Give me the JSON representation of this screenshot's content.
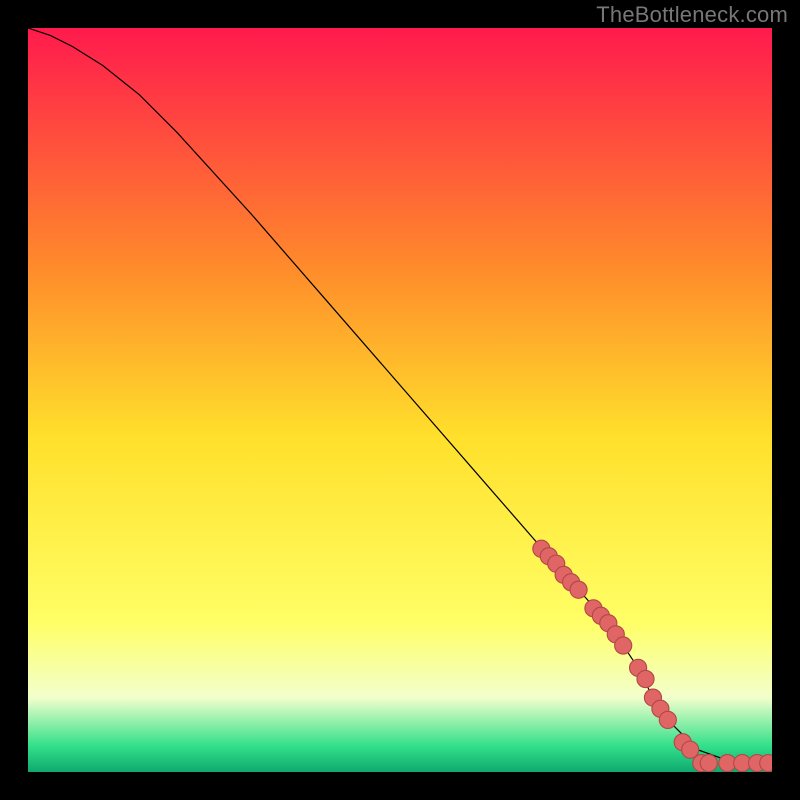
{
  "watermark": "TheBottleneck.com",
  "colors": {
    "page_bg": "#000000",
    "watermark": "#777777",
    "curve": "#000000",
    "marker_fill": "#e06666",
    "marker_stroke": "#b34747",
    "gradient_top": "#ff1a4d",
    "gradient_mid_upper": "#ff8a2b",
    "gradient_mid": "#ffe02b",
    "gradient_mid_lower": "#ffff66",
    "gradient_pale": "#f2ffcc",
    "gradient_green": "#32e08a",
    "gradient_green_deep": "#0fa96f"
  },
  "chart_data": {
    "type": "line",
    "title": "",
    "xlabel": "",
    "ylabel": "",
    "xlim": [
      0,
      100
    ],
    "ylim": [
      0,
      100
    ],
    "grid": false,
    "curve": {
      "x": [
        0,
        3,
        6,
        10,
        15,
        20,
        30,
        40,
        50,
        60,
        70,
        78,
        82,
        84,
        86,
        90,
        95,
        100
      ],
      "y": [
        100,
        99,
        97.5,
        95,
        91,
        86,
        75,
        63.5,
        52,
        40.5,
        29,
        20,
        14,
        10,
        7,
        3,
        1.2,
        1
      ]
    },
    "markers": {
      "x": [
        69,
        70,
        71,
        72,
        73,
        74,
        76,
        77,
        78,
        79,
        80,
        82,
        83,
        84,
        85,
        86,
        88,
        89,
        90.5,
        91.5,
        94,
        96,
        98,
        99.5
      ],
      "y": [
        30,
        29,
        28,
        26.5,
        25.5,
        24.5,
        22,
        21,
        20,
        18.5,
        17,
        14,
        12.5,
        10,
        8.5,
        7,
        4,
        3,
        1.2,
        1.2,
        1.2,
        1.2,
        1.2,
        1.2
      ]
    }
  }
}
